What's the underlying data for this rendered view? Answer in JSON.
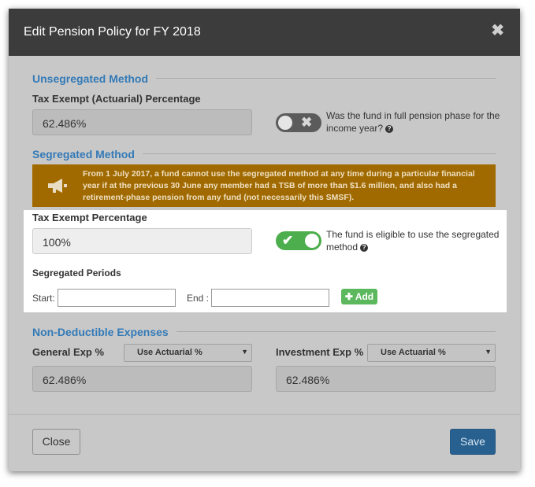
{
  "modal": {
    "title": "Edit Pension Policy for FY 2018",
    "close_icon": "close-icon"
  },
  "unsegregated": {
    "section_title": "Unsegregated Method",
    "percentage_label": "Tax Exempt (Actuarial) Percentage",
    "percentage_value": "62.486%",
    "toggle_state": "off",
    "toggle_text": "Was the fund in full pension phase for the income year?"
  },
  "segregated": {
    "section_title": "Segregated Method",
    "banner_icon": "megaphone-icon",
    "banner_text": "From 1 July 2017, a fund cannot use the segregated method at any time during a particular financial year if at the previous 30 June any member had a TSB of more than $1.6 million, and also had a retirement-phase pension from any fund (not necessarily this SMSF).",
    "percentage_label": "Tax Exempt Percentage",
    "percentage_value": "100%",
    "toggle_state": "on",
    "toggle_text": "The fund is eligible to use the segregated method",
    "periods_label": "Segregated Periods",
    "start_label": "Start:",
    "start_value": "",
    "end_label": "End :",
    "end_value": "",
    "add_label": "Add"
  },
  "non_deductible": {
    "section_title": "Non-Deductible Expenses",
    "general_label": "General Exp %",
    "general_select": "Use Actuarial %",
    "general_value": "62.486%",
    "investment_label": "Investment Exp %",
    "investment_select": "Use Actuarial %",
    "investment_value": "62.486%"
  },
  "footer": {
    "close_label": "Close",
    "save_label": "Save"
  },
  "colors": {
    "header": "#3c3c3c",
    "accent_blue": "#337ab7",
    "banner": "#a06a00",
    "toggle_on": "#4cae4c",
    "save_button": "#286090"
  }
}
